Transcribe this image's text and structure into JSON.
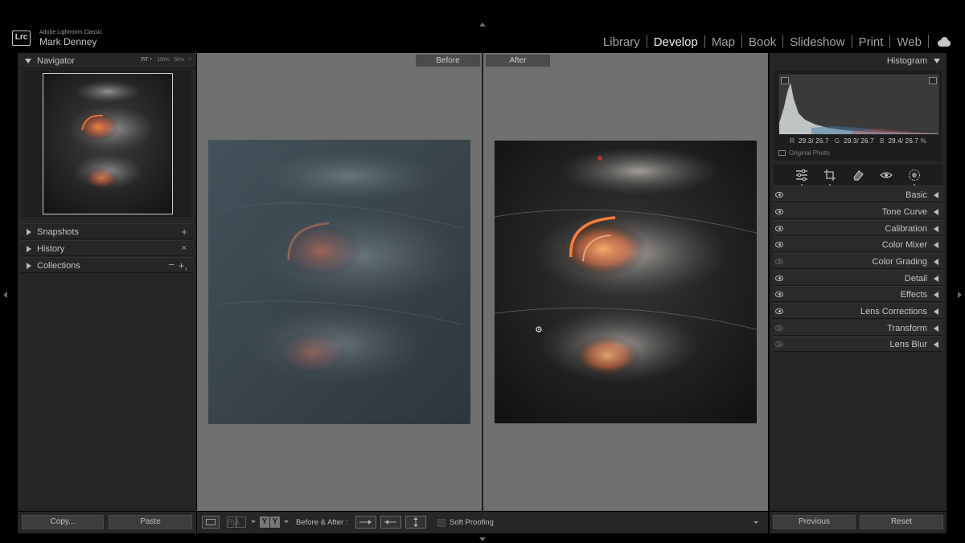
{
  "app": {
    "badge": "Lrc",
    "name": "Adobe Lightroom Classic",
    "user": "Mark Denney"
  },
  "modules": [
    "Library",
    "Develop",
    "Map",
    "Book",
    "Slideshow",
    "Print",
    "Web"
  ],
  "active_module": "Develop",
  "left_panel": {
    "navigator": {
      "title": "Navigator",
      "zoom_options": [
        "FIT ÷",
        "100%",
        "50%",
        "÷"
      ]
    },
    "snapshots": {
      "title": "Snapshots",
      "action": "+"
    },
    "history": {
      "title": "History",
      "action": "×"
    },
    "collections": {
      "title": "Collections",
      "minus": "−",
      "plus": "+,"
    }
  },
  "center": {
    "before_label": "Before",
    "after_label": "After"
  },
  "right_panel": {
    "histogram": {
      "title": "Histogram",
      "readout": {
        "r_label": "R",
        "r": "29.3/ 26.7",
        "g_label": "G",
        "g": "29.3/ 26.7",
        "b_label": "B",
        "b": "29.4/ 26.7",
        "unit": "%"
      },
      "original_photo": "Original Photo"
    },
    "tools": [
      "edit-sliders",
      "crop",
      "heal",
      "redeye",
      "masking"
    ],
    "sections": [
      {
        "label": "Basic",
        "visible": true
      },
      {
        "label": "Tone Curve",
        "visible": true
      },
      {
        "label": "Calibration",
        "visible": true
      },
      {
        "label": "Color Mixer",
        "visible": true
      },
      {
        "label": "Color Grading",
        "visible": false
      },
      {
        "label": "Detail",
        "visible": true
      },
      {
        "label": "Effects",
        "visible": true
      },
      {
        "label": "Lens Corrections",
        "visible": true
      },
      {
        "label": "Transform",
        "visible": false
      },
      {
        "label": "Lens Blur",
        "visible": false
      }
    ]
  },
  "bottom": {
    "copy": "Copy...",
    "paste": "Paste",
    "ra": "R|A",
    "yy_left": "Y",
    "yy_right": "Y",
    "before_after": "Before & After :",
    "soft_proofing": "Soft Proofing",
    "previous": "Previous",
    "reset": "Reset"
  },
  "colors": {
    "panel": "#262626",
    "center_bg": "#707070",
    "accent_glow": "#e2622f"
  }
}
